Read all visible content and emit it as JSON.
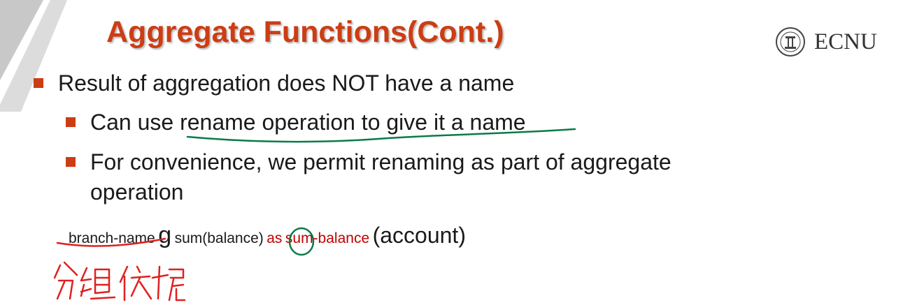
{
  "slide": {
    "title": "Aggregate Functions(Cont.)",
    "logo_text": "ECNU",
    "bullets": [
      "Result of aggregation does NOT have a name",
      "Can use rename operation to give it a name",
      "For convenience, we permit renaming as part of aggregate",
      "operation"
    ]
  },
  "formula": {
    "group_attr": "branch-name",
    "g": "g",
    "agg": "sum(balance)",
    "as_kw": "as",
    "new_name": "sum-balance",
    "relation": "(account)"
  },
  "colors": {
    "accent": "#cc3d14",
    "ink_green": "#0a7a4a",
    "ink_red": "#e02020",
    "keyword_red": "#c00000"
  },
  "icons": [
    "ecnu-seal-icon"
  ]
}
